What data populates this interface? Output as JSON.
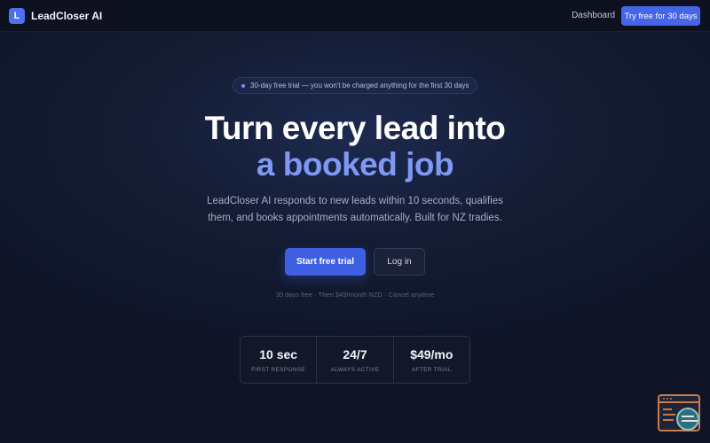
{
  "nav": {
    "brand_initial": "L",
    "brand_name": "LeadCloser AI",
    "dashboard_link": "Dashboard",
    "cta_label": "Try free for 30 days"
  },
  "hero": {
    "badge_text": "30-day free trial — you won't be charged anything for the first 30 days",
    "headline_line1": "Turn every lead into",
    "headline_line2": "a booked job",
    "subtext": "LeadCloser AI responds to new leads within 10 seconds, qualifies them, and books appointments automatically. Built for NZ tradies.",
    "primary_button": "Start free trial",
    "secondary_button": "Log in",
    "fine_print": "30 days free · Then $49/month NZD · Cancel anytime"
  },
  "stats": [
    {
      "value": "10 sec",
      "label": "FIRST RESPONSE"
    },
    {
      "value": "24/7",
      "label": "ALWAYS ACTIVE"
    },
    {
      "value": "$49/mo",
      "label": "AFTER TRIAL"
    }
  ],
  "widget": {
    "icon": "chat-support-icon"
  },
  "colors": {
    "accent": "#4865e8",
    "headline_accent": "#7f98f4",
    "background": "#141c33",
    "widget_border": "#c97b4a"
  }
}
